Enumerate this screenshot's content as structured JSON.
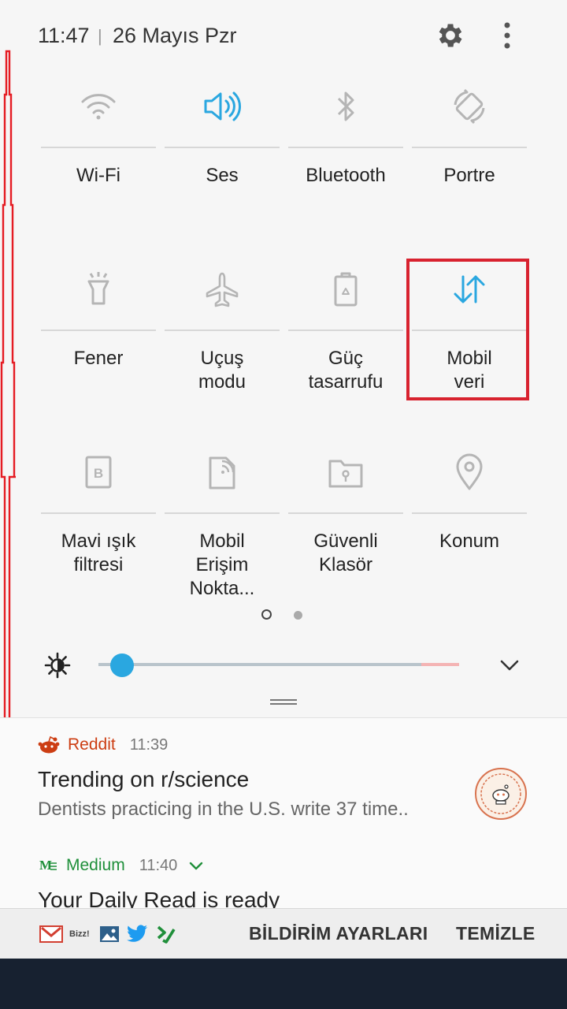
{
  "status": {
    "time": "11:47",
    "separator": "|",
    "date": "26 Mayıs Pzr"
  },
  "tiles": [
    {
      "label": "Wi-Fi",
      "icon": "wifi-icon",
      "active": false
    },
    {
      "label": "Ses",
      "icon": "speaker-icon",
      "active": true
    },
    {
      "label": "Bluetooth",
      "icon": "bluetooth-icon",
      "active": false
    },
    {
      "label": "Portre",
      "icon": "rotate-icon",
      "active": false
    },
    {
      "label": "Fener",
      "icon": "flashlight-icon",
      "active": false
    },
    {
      "label": "Uçuş\nmodu",
      "icon": "airplane-icon",
      "active": false
    },
    {
      "label": "Güç\ntasarrufu",
      "icon": "battery-saver-icon",
      "active": false
    },
    {
      "label": "Mobil\nveri",
      "icon": "mobile-data-icon",
      "active": true
    },
    {
      "label": "Mavi ışık\nfiltresi",
      "icon": "blue-light-filter-icon",
      "active": false
    },
    {
      "label": "Mobil\nErişim Nokta...",
      "icon": "hotspot-icon",
      "active": false
    },
    {
      "label": "Güvenli\nKlasör",
      "icon": "secure-folder-icon",
      "active": false
    },
    {
      "label": "Konum",
      "icon": "location-icon",
      "active": false
    }
  ],
  "page_indicator": {
    "current": 1,
    "total": 2
  },
  "brightness": {
    "level": 0.07
  },
  "colors": {
    "accent": "#2aa7e0",
    "highlight_border": "#d8222f",
    "reddit": "#cc3d12",
    "medium": "#1f8f3a"
  },
  "notifications": [
    {
      "app": "Reddit",
      "time": "11:39",
      "title": "Trending on r/science",
      "text": "Dentists practicing in the U.S. write 37 time.."
    },
    {
      "app": "Medium",
      "time": "11:40",
      "title": "Your Daily Read is ready"
    }
  ],
  "footer": {
    "bizz_label": "Bizz!",
    "settings_label": "BİLDİRİM AYARLARI",
    "clear_label": "TEMİZLE"
  }
}
